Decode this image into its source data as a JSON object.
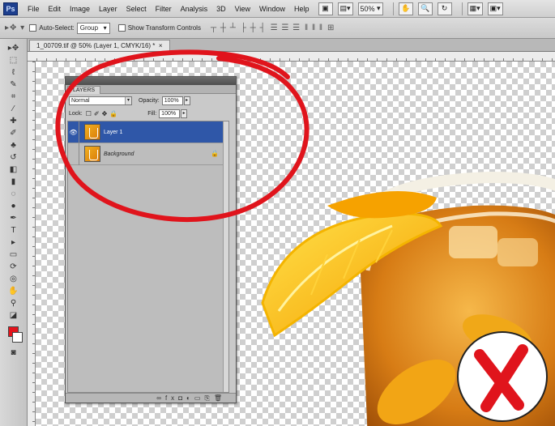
{
  "app": {
    "logo": "Ps"
  },
  "menu": [
    "File",
    "Edit",
    "Image",
    "Layer",
    "Select",
    "Filter",
    "Analysis",
    "3D",
    "View",
    "Window",
    "Help"
  ],
  "menubar_tools": {
    "zoom_value": "50%"
  },
  "options_bar": {
    "auto_select_label": "Auto-Select:",
    "auto_select_value": "Group",
    "show_transform_label": "Show Transform Controls"
  },
  "document": {
    "tab_title": "1_00709.tif @ 50% (Layer 1, CMYK/16) *"
  },
  "layers_panel": {
    "tab_label": "LAYERS",
    "blend_mode": "Normal",
    "opacity_label": "Opacity:",
    "opacity_value": "100%",
    "lock_label": "Lock:",
    "fill_label": "Fill:",
    "fill_value": "100%",
    "layers": [
      {
        "name": "Layer 1",
        "selected": true
      },
      {
        "name": "Background",
        "selected": false
      }
    ]
  },
  "colors": {
    "foreground": "#e4141c",
    "background": "#ffffff",
    "annotation_red": "#e0141c",
    "selection_blue": "#2f57a8"
  },
  "icons": [
    "eye-icon",
    "lock-icon",
    "move-tool-icon",
    "red-x-mark-icon"
  ]
}
